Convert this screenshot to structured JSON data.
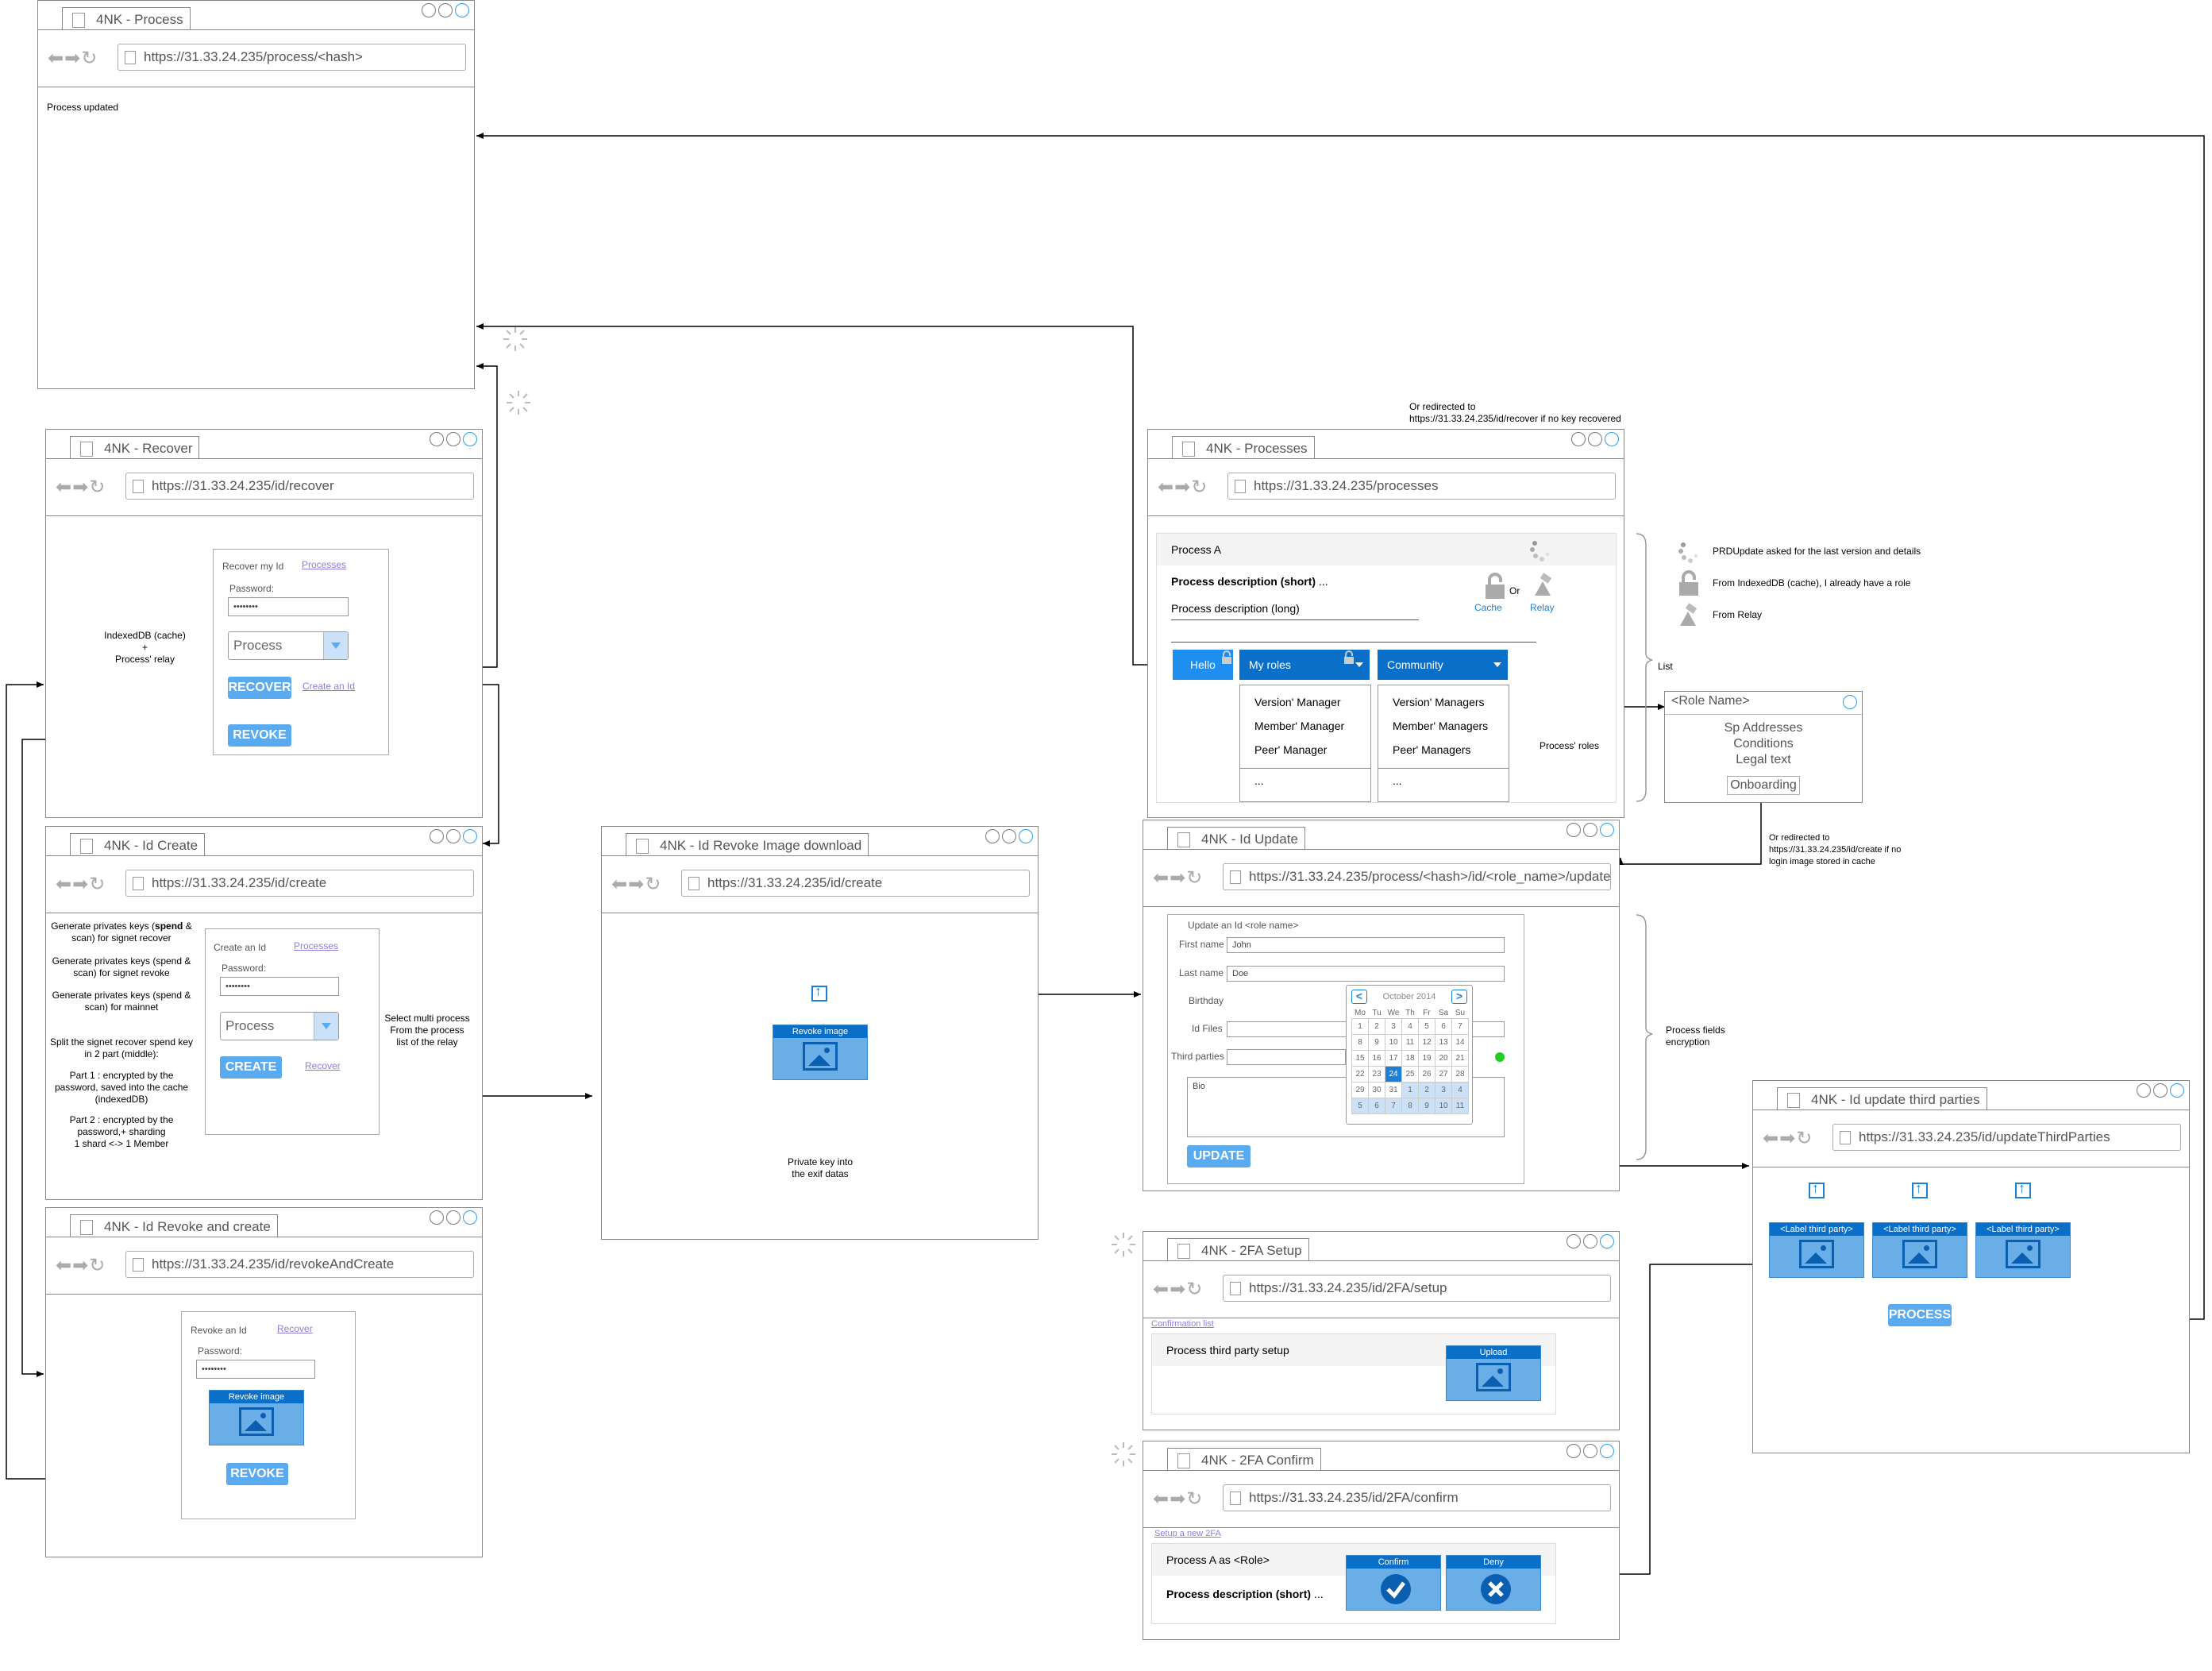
{
  "colors": {
    "accent": "#0a6fc9",
    "button": "#5aaaf0",
    "link": "#8a7fe0",
    "green": "#22cc22"
  },
  "w_process": {
    "tab": "4NK - Process",
    "url": "https://31.33.24.235/process/<hash>",
    "text": "Process updated"
  },
  "w_recover": {
    "tab": "4NK - Recover",
    "url": "https://31.33.24.235/id/recover",
    "title": "Recover my Id",
    "processes": "Processes",
    "password_label": "Password:",
    "password": "••••••••",
    "combo": "Process",
    "recover_btn": "RECOVER",
    "create_link": "Create an Id",
    "revoke_btn": "REVOKE",
    "note": "IndexedDB (cache)\n+\nProcess' relay"
  },
  "w_create": {
    "tab": "4NK - Id Create",
    "url": "https://31.33.24.235/id/create",
    "title": "Create an Id",
    "processes": "Processes",
    "password_label": "Password:",
    "password": "••••••••",
    "combo": "Process",
    "create_btn": "CREATE",
    "recover_link": "Recover",
    "note_left_1a": "Generate privates keys (",
    "note_left_1b": "spend",
    "note_left_1c": " & scan) for signet recover",
    "note_left_2": "Generate privates keys (spend & scan) for signet revoke",
    "note_left_3": "Generate privates keys (spend & scan) for mainnet",
    "note_left_4": "Split the signet recover spend key in 2 part (middle):",
    "note_left_5": "Part 1 : encrypted by the password, saved into the cache (indexedDB)",
    "note_left_6": "Part 2 : encrypted by the password,+ sharding\n1 shard <-> 1 Member",
    "note_right": "Select multi process\nFrom the process\nlist of the relay"
  },
  "w_revoke_create": {
    "tab": "4NK - Id Revoke and create",
    "url": "https://31.33.24.235/id/revokeAndCreate",
    "title": "Revoke an Id",
    "recover_link": "Recover",
    "password_label": "Password:",
    "password": "••••••••",
    "image_label": "Revoke image",
    "revoke_btn": "REVOKE"
  },
  "w_revoke_dl": {
    "tab": "4NK - Id Revoke Image download",
    "url": "https://31.33.24.235/id/create",
    "image_label": "Revoke image",
    "note": "Private key into\nthe exif datas"
  },
  "w_processes": {
    "tab": "4NK - Processes",
    "url": "https://31.33.24.235/processes",
    "process_name": "Process A",
    "desc_short": "Process description (short)",
    "desc_short_tail": " ...",
    "desc_long": "Process description (long)",
    "cache": "Cache",
    "or": "Or",
    "relay": "Relay",
    "hello": "Hello",
    "my_roles": "My roles",
    "community": "Community",
    "roles_menu": [
      "Version' Manager",
      "Member' Manager",
      "Peer' Manager",
      "..."
    ],
    "community_menu": [
      "Version' Managers",
      "Member' Managers",
      "Peer' Managers",
      "..."
    ],
    "note_top": "Or redirected to\nhttps://31.33.24.235/id/recover if no key recovered",
    "list": "List",
    "roles_note": "Process' roles"
  },
  "legend": {
    "l1": "PRDUpdate asked for the last version and details",
    "l2": "From IndexedDB (cache), I already have a role",
    "l3": "From Relay"
  },
  "role_card": {
    "title": "<Role Name>",
    "line1": "Sp Addresses",
    "line2": "Conditions",
    "line3": "Legal text",
    "btn": "Onboarding",
    "note": "Or redirected to\nhttps://31.33.24.235/id/create if no\nlogin image stored in cache"
  },
  "w_update": {
    "tab": "4NK - Id Update",
    "url": "https://31.33.24.235/process/<hash>/id/<role_name>/update",
    "title": "Update an Id <role name>",
    "first_label": "First name",
    "first": "John",
    "last_label": "Last name",
    "last": "Doe",
    "birthday_label": "Birthday",
    "idfiles_label": "Id Files",
    "third_label": "Third parties",
    "bio_label": "Bio",
    "update_btn": "UPDATE",
    "note": "Process fields\nencryption",
    "calendar": {
      "month": "October 2014",
      "days": [
        "Mo",
        "Tu",
        "We",
        "Th",
        "Fr",
        "Sa",
        "Su"
      ],
      "rows": [
        [
          "1",
          "2",
          "3",
          "4",
          "5",
          "6",
          "7"
        ],
        [
          "8",
          "9",
          "10",
          "11",
          "12",
          "13",
          "14"
        ],
        [
          "15",
          "16",
          "17",
          "18",
          "19",
          "20",
          "21"
        ],
        [
          "22",
          "23",
          "24",
          "25",
          "26",
          "27",
          "28"
        ],
        [
          "29",
          "30",
          "31",
          "1",
          "2",
          "3",
          "4"
        ],
        [
          "5",
          "6",
          "7",
          "8",
          "9",
          "10",
          "11"
        ]
      ],
      "selected": "24"
    }
  },
  "w_third": {
    "tab": "4NK - Id update third parties",
    "url": "https://31.33.24.235/id/updateThirdParties",
    "labels": [
      "<Label third party>",
      "<Label third party>",
      "<Label third party>"
    ],
    "process_btn": "PROCESS"
  },
  "w_2fa_setup": {
    "tab": "4NK - 2FA Setup",
    "url": "https://31.33.24.235/id/2FA/setup",
    "link": "Confirmation list",
    "row": "Process third party setup",
    "upload": "Upload"
  },
  "w_2fa_confirm": {
    "tab": "4NK - 2FA Confirm",
    "url": "https://31.33.24.235/id/2FA/confirm",
    "link": "Setup a new 2FA",
    "row1": "Process A as <Role>",
    "row2": "Process description (short)",
    "row2_tail": " ...",
    "confirm": "Confirm",
    "deny": "Deny"
  }
}
